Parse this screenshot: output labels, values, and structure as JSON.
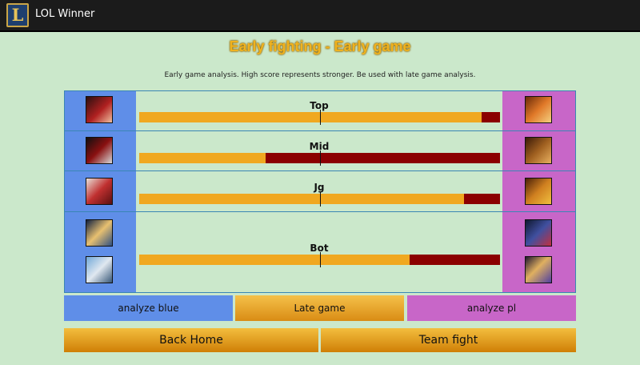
{
  "app": {
    "title": "LOL Winner",
    "icon_letter": "L"
  },
  "page": {
    "title": "Early fighting - Early game",
    "subtitle": "Early game analysis. High score represents stronger. Be used with late game analysis."
  },
  "lanes": [
    {
      "label": "Top",
      "blue_fraction": 0.95
    },
    {
      "label": "Mid",
      "blue_fraction": 0.35
    },
    {
      "label": "Jg",
      "blue_fraction": 0.9
    },
    {
      "label": "Bot",
      "blue_fraction": 0.75
    }
  ],
  "buttons": {
    "analyze_blue": "analyze blue",
    "late_game": "Late game",
    "analyze_pl": "analyze pl",
    "back_home": "Back Home",
    "team_fight": "Team fight"
  },
  "colors": {
    "blue_team": "#5f8ee8",
    "red_team": "#c866c8",
    "bar_blue_score": "#f0a820",
    "bar_red_score": "#8b0000",
    "background": "#cbe8cb"
  }
}
